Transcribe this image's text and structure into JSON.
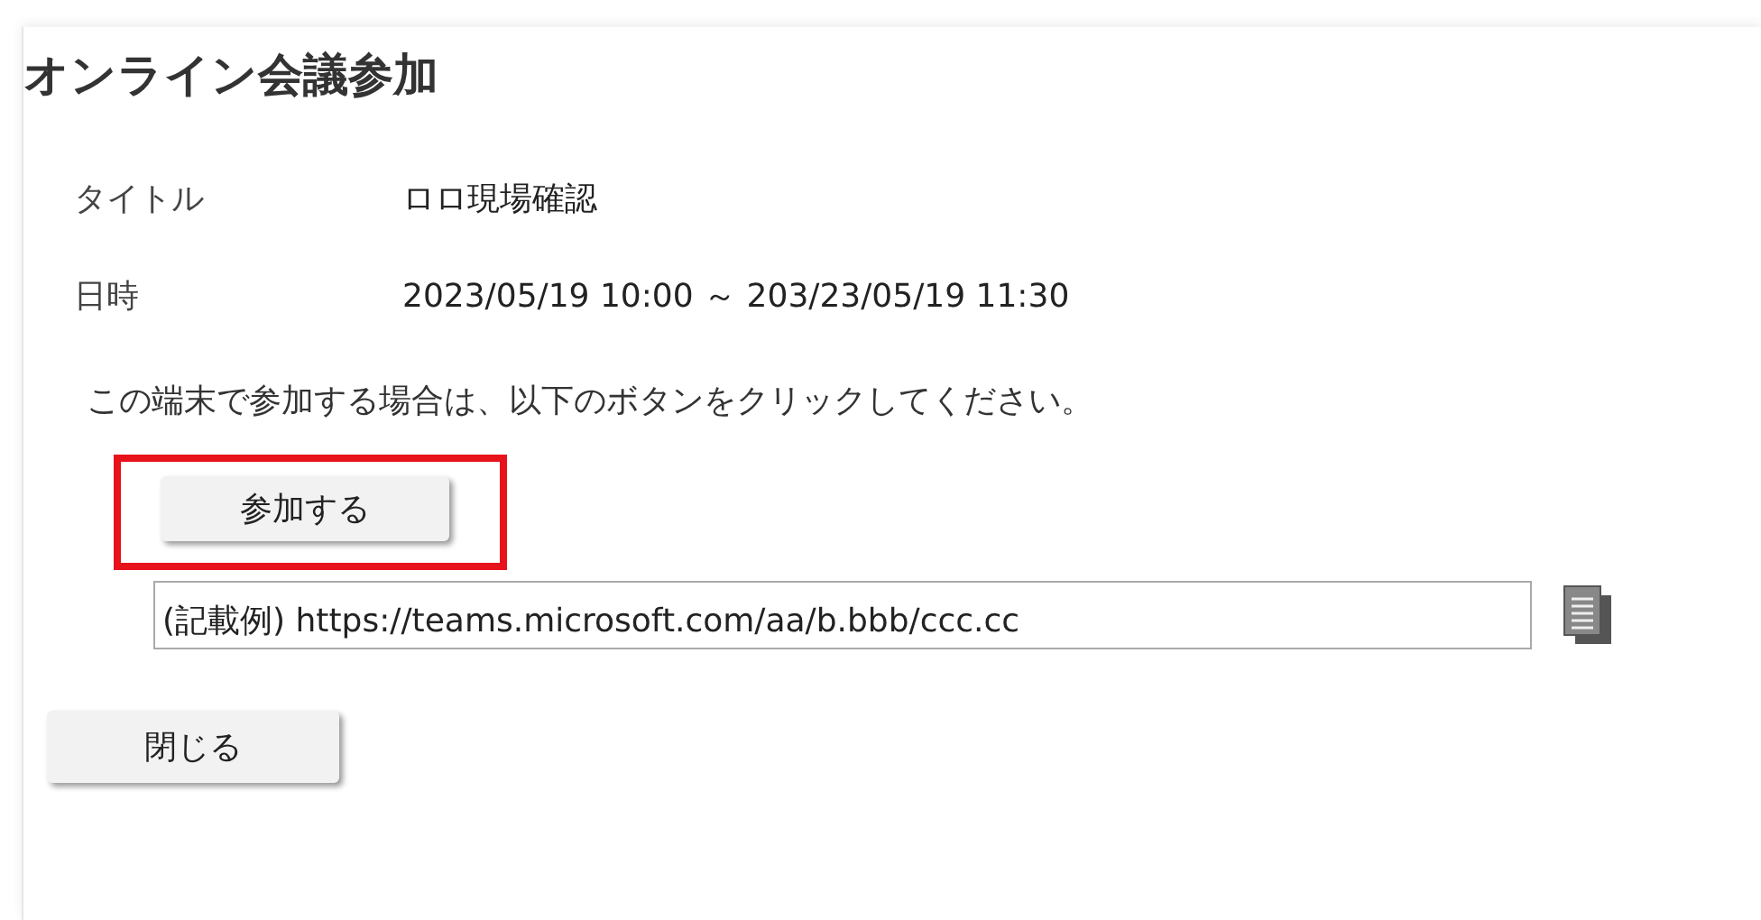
{
  "title": "オンライン会議参加",
  "fields": [
    {
      "label": "タイトル",
      "value": "ロロ現場確認"
    },
    {
      "label": "日時",
      "value": "2023/05/19 10:00 ～ 203/23/05/19 11:30"
    }
  ],
  "instruction": "この端末で参加する場合は、以下のボタンをクリックしてください。",
  "join_button": {
    "label": "参加する",
    "highlighted": true
  },
  "url_field": {
    "value": "(記載例) https://teams.microsoft.com/aa/b.bbb/ccc.cc"
  },
  "close_button": {
    "label": "閉じる"
  }
}
